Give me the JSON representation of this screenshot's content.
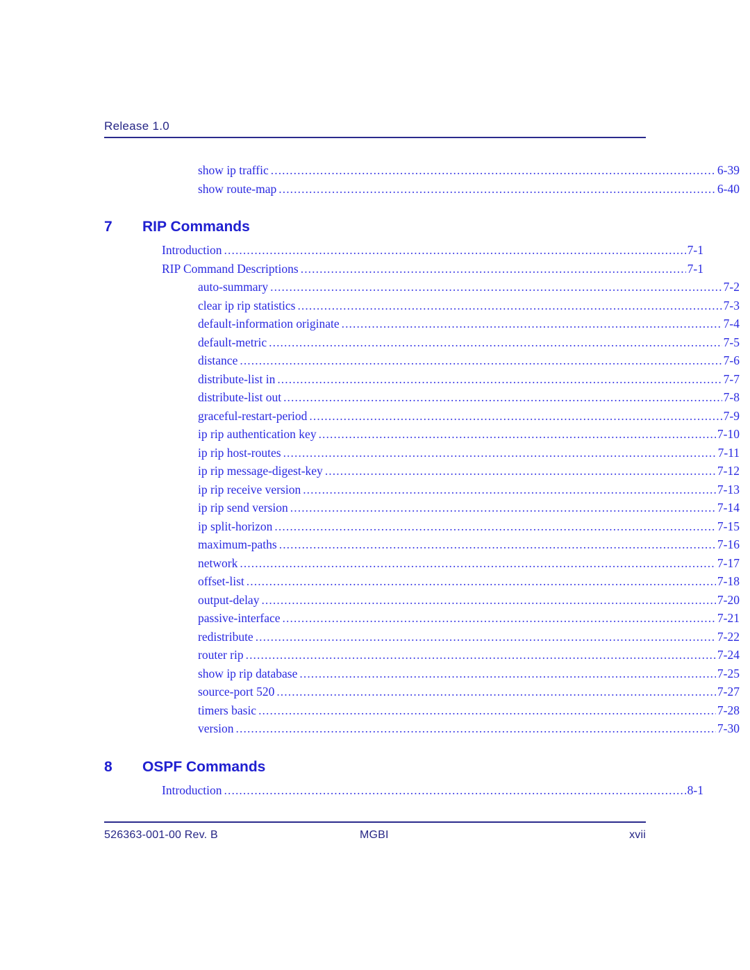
{
  "header": {
    "title": "Release 1.0"
  },
  "toc": {
    "continued_entries": [
      {
        "label": "show ip traffic",
        "page": "6-39",
        "level": 2
      },
      {
        "label": "show route-map",
        "page": "6-40",
        "level": 2
      }
    ],
    "chapters": [
      {
        "number": "7",
        "title": "RIP Commands",
        "entries": [
          {
            "label": "Introduction",
            "page": "7-1",
            "level": 1
          },
          {
            "label": "RIP Command Descriptions",
            "page": "7-1",
            "level": 1
          },
          {
            "label": "auto-summary",
            "page": "7-2",
            "level": 2
          },
          {
            "label": "clear ip rip statistics",
            "page": "7-3",
            "level": 2
          },
          {
            "label": "default-information originate",
            "page": "7-4",
            "level": 2
          },
          {
            "label": "default-metric",
            "page": "7-5",
            "level": 2
          },
          {
            "label": "distance",
            "page": "7-6",
            "level": 2
          },
          {
            "label": "distribute-list in",
            "page": "7-7",
            "level": 2
          },
          {
            "label": "distribute-list out",
            "page": "7-8",
            "level": 2
          },
          {
            "label": "graceful-restart-period",
            "page": "7-9",
            "level": 2
          },
          {
            "label": "ip rip authentication key",
            "page": "7-10",
            "level": 2
          },
          {
            "label": "ip rip host-routes",
            "page": "7-11",
            "level": 2
          },
          {
            "label": "ip rip message-digest-key",
            "page": "7-12",
            "level": 2
          },
          {
            "label": "ip rip receive version",
            "page": "7-13",
            "level": 2
          },
          {
            "label": "ip rip send version",
            "page": "7-14",
            "level": 2
          },
          {
            "label": "ip split-horizon",
            "page": "7-15",
            "level": 2
          },
          {
            "label": "maximum-paths",
            "page": "7-16",
            "level": 2
          },
          {
            "label": "network",
            "page": "7-17",
            "level": 2
          },
          {
            "label": "offset-list",
            "page": "7-18",
            "level": 2
          },
          {
            "label": "output-delay",
            "page": "7-20",
            "level": 2
          },
          {
            "label": "passive-interface",
            "page": "7-21",
            "level": 2
          },
          {
            "label": "redistribute",
            "page": "7-22",
            "level": 2
          },
          {
            "label": "router rip",
            "page": "7-24",
            "level": 2
          },
          {
            "label": "show ip rip database",
            "page": "7-25",
            "level": 2
          },
          {
            "label": "source-port 520",
            "page": "7-27",
            "level": 2
          },
          {
            "label": "timers basic",
            "page": "7-28",
            "level": 2
          },
          {
            "label": "version",
            "page": "7-30",
            "level": 2
          }
        ]
      },
      {
        "number": "8",
        "title": "OSPF Commands",
        "entries": [
          {
            "label": "Introduction",
            "page": "8-1",
            "level": 1
          }
        ]
      }
    ]
  },
  "footer": {
    "document_number": "526363-001-00 Rev. B",
    "center": "MGBI",
    "page_number": "xvii"
  },
  "colors": {
    "entry_blue": "#2a2ae0",
    "heading_blue": "#2020d0",
    "navy": "#252585",
    "rule": "#2a2a8c"
  }
}
